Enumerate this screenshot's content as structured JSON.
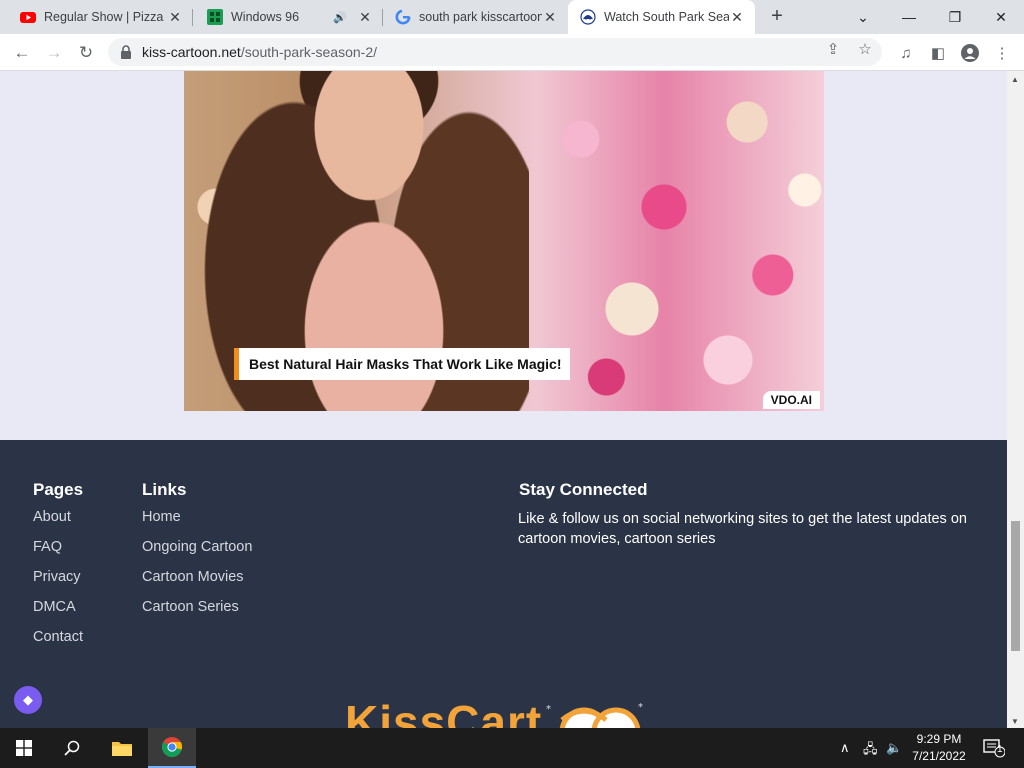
{
  "tabs": [
    {
      "title": "Regular Show | Pizza Po",
      "favicon": "youtube-icon",
      "audio": false,
      "active": false
    },
    {
      "title": "Windows 96",
      "favicon": "windows96-icon",
      "audio": true,
      "active": false
    },
    {
      "title": "south park kisscartoon",
      "favicon": "google-icon",
      "audio": false,
      "active": false
    },
    {
      "title": "Watch South Park Seas",
      "favicon": "kisscartoon-icon",
      "audio": false,
      "active": true
    }
  ],
  "address_bar": {
    "domain": "kiss-cartoon.net",
    "path": "/south-park-season-2/"
  },
  "ad": {
    "caption": "Best Natural Hair Masks That Work Like Magic!",
    "brand": "VDO.AI",
    "accent_color": "#f28c1a"
  },
  "footer": {
    "pages": {
      "heading": "Pages",
      "items": [
        "About",
        "FAQ",
        "Privacy",
        "DMCA",
        "Contact"
      ]
    },
    "links": {
      "heading": "Links",
      "items": [
        "Home",
        "Ongoing Cartoon",
        "Cartoon Movies",
        "Cartoon Series"
      ]
    },
    "stay_connected": {
      "heading": "Stay Connected",
      "text": "Like & follow us on social networking sites to get the latest updates on cartoon movies, cartoon series"
    },
    "logo_text": "KissCart",
    "background_color": "#2b3346"
  },
  "taskbar": {
    "time": "9:29 PM",
    "date": "7/21/2022",
    "notification_count": "1"
  }
}
